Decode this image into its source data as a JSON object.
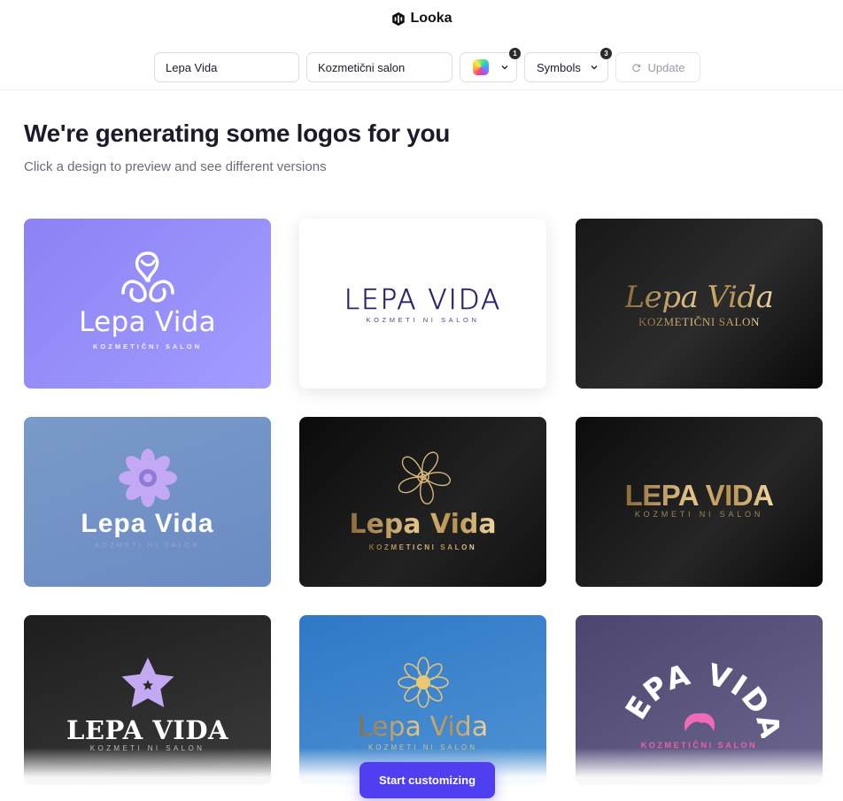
{
  "app": {
    "brand": "Looka"
  },
  "controls": {
    "company_name": "Lepa Vida",
    "industry": "Kozmetični salon",
    "colors_count": "1",
    "symbols_label": "Symbols",
    "symbols_count": "3",
    "update_label": "Update"
  },
  "page": {
    "title": "We're generating some logos for you",
    "subtitle": "Click a design to preview and see different versions"
  },
  "logos": [
    {
      "name": "Lepa Vida",
      "tagline": "KOZMETIČNI SALON",
      "icon": "hands-leaf-icon",
      "background": "#9a93fb"
    },
    {
      "name": "LEPA VIDA",
      "tagline": "KOZMETI NI SALON",
      "icon": "none",
      "background": "#ffffff"
    },
    {
      "name": "Lepa Vida",
      "tagline": "KOZMETIČNI SALON",
      "icon": "none",
      "background": "#1e1e1e"
    },
    {
      "name": "Lepa Vida",
      "tagline": "KOZMETI NI SALON",
      "icon": "lotus-mandala-icon",
      "background": "#7394c6"
    },
    {
      "name": "Lepa Vida",
      "tagline": "KOZMETIČNI SALON",
      "icon": "flower-outline-icon",
      "background": "#181818"
    },
    {
      "name": "LEPA VIDA",
      "tagline": "KOZMETI NI SALON",
      "icon": "none",
      "background": "#1a1a1a"
    },
    {
      "name": "LEPA VIDA",
      "tagline": "KOZMETI NI SALON",
      "icon": "star-flower-icon",
      "background": "#2d2d2d"
    },
    {
      "name": "Lepa Vida",
      "tagline": "KOZMETI NI SALON",
      "icon": "gold-lotus-icon",
      "background": "#3b84cc"
    },
    {
      "name": "LEPA VIDA",
      "tagline": "KOZMETIČNI SALON",
      "icon": "hair-icon",
      "background": "#5b5680"
    }
  ],
  "cta": {
    "label": "Start customizing"
  },
  "colors": {
    "accent": "#4f3ff0",
    "gold": "#d4b06a"
  }
}
